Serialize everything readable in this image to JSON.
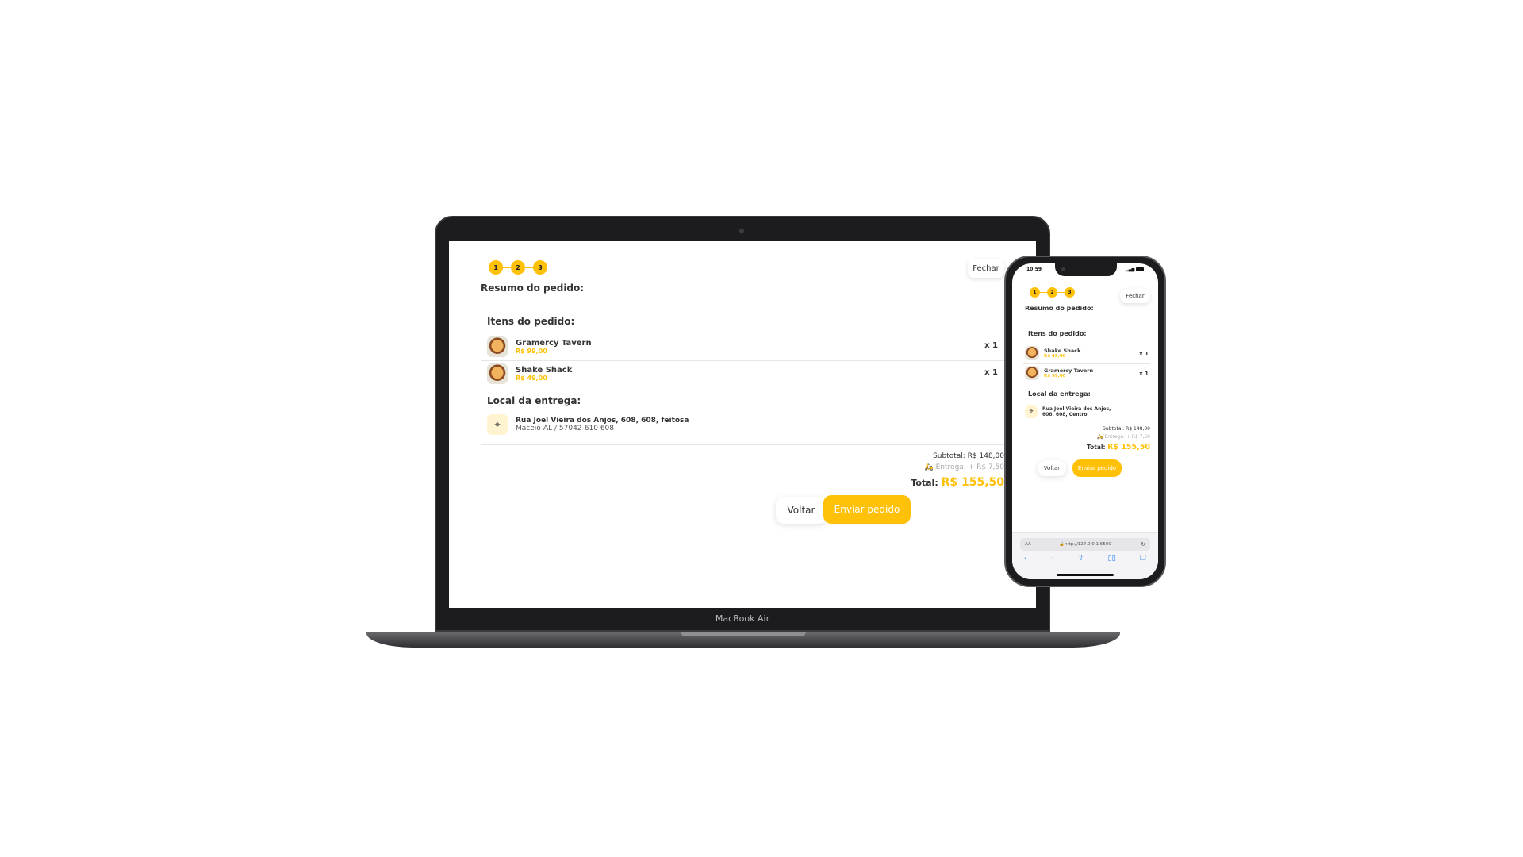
{
  "device_laptop": {
    "brand_label": "MacBook Air"
  },
  "steps": [
    "1",
    "2",
    "3"
  ],
  "close_label": "Fechar",
  "summary_title": "Resumo do pedido:",
  "items_title": "Itens do pedido:",
  "laptop_items": [
    {
      "name": "Gramercy Tavern",
      "price": "R$ 99,00",
      "qty": "x 1"
    },
    {
      "name": "Shake Shack",
      "price": "R$ 49,00",
      "qty": "x 1"
    }
  ],
  "phone_items": [
    {
      "name": "Shake Shack",
      "price": "R$ 49,00",
      "qty": "x 1"
    },
    {
      "name": "Gramercy Tavern",
      "price": "R$ 99,00",
      "qty": "x 1"
    }
  ],
  "delivery_title": "Local da entrega:",
  "address": {
    "line1": "Rua Joel Vieira dos Anjos, 608, 608, feitosa",
    "line2": "Maceió-AL / 57042-610 608",
    "phone_line1": "Rua Joel Vieira dos Anjos,",
    "phone_line2": "608, 608, Centro"
  },
  "totals": {
    "subtotal": "Subtotal: R$ 148,00",
    "delivery": "Entrega: + R$ 7,50",
    "total_label": "Total:",
    "total_amount": "R$ 155,50"
  },
  "back_label": "Voltar",
  "send_label": "Enviar pedido",
  "phone_status": {
    "time": "10:59"
  },
  "browser": {
    "aa": "AA",
    "url": "http://127.0.0.1:5500"
  },
  "colors": {
    "accent": "#FFC107",
    "text": "#333333",
    "muted": "#a8a8a8"
  },
  "icons": [
    "burger-thumbnail",
    "map-pin-icon",
    "delivery-bike-icon",
    "lock-icon",
    "reload-icon",
    "back-icon",
    "forward-icon",
    "share-icon",
    "bookmarks-icon",
    "tabs-icon"
  ]
}
